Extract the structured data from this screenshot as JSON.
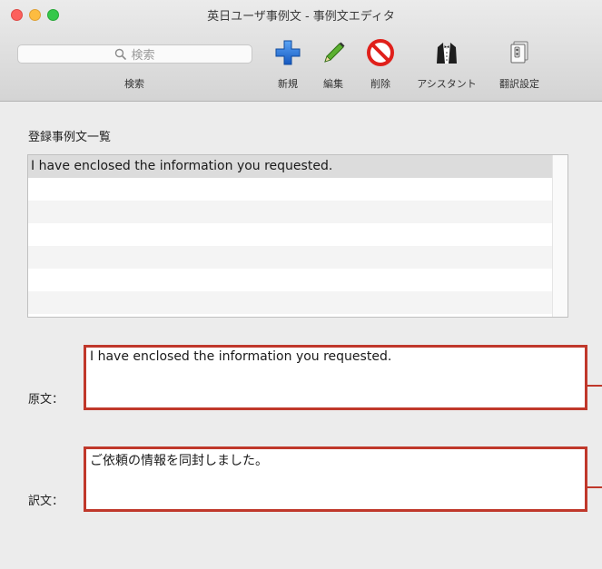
{
  "window": {
    "title": "英日ユーザ事例文 - 事例文エディタ"
  },
  "toolbar": {
    "search_placeholder": "検索",
    "search_caption": "検索",
    "buttons": [
      {
        "id": "new",
        "label": "新規",
        "icon": "plus-icon"
      },
      {
        "id": "edit",
        "label": "編集",
        "icon": "pencil-icon"
      },
      {
        "id": "delete",
        "label": "削除",
        "icon": "prohibit-icon"
      },
      {
        "id": "assistant",
        "label": "アシスタント",
        "icon": "tuxedo-icon"
      },
      {
        "id": "translation_settings",
        "label": "翻訳設定",
        "icon": "settings-doc-icon"
      }
    ]
  },
  "list": {
    "heading": "登録事例文一覧",
    "items": [
      "I have enclosed the information you requested."
    ],
    "selected_index": 0
  },
  "editor": {
    "source_label": "原文：",
    "source_text": "I have enclosed the information you requested.",
    "translation_label": "訳文：",
    "translation_text": "ご依頼の情報を同封しました。"
  },
  "colors": {
    "highlight_border": "#c0382b",
    "plus_blue": "#1d6fd9",
    "prohibit_red": "#e0201b"
  }
}
